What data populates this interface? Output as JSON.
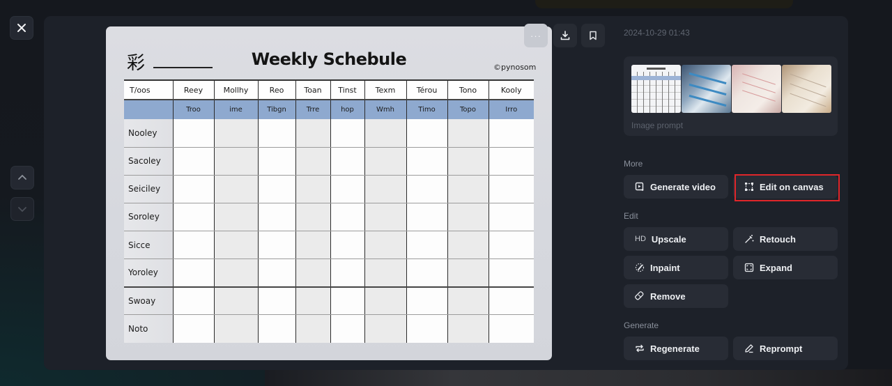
{
  "window": {
    "close_icon": "close-icon",
    "nav_up_icon": "chevron-up-icon",
    "nav_down_icon": "chevron-down-icon"
  },
  "image": {
    "logo_glyph": "彩",
    "title": "Weekly Schebule",
    "copyright": "©pynosom",
    "table": {
      "headers": [
        "T/oos",
        "Reey",
        "Mollhy",
        "Reo",
        "Toan",
        "Tinst",
        "Texm",
        "Térou",
        "Tono",
        "Kooly"
      ],
      "subheaders": [
        "",
        "Troo",
        "ime",
        "Tibgn",
        "Trre",
        "hop",
        "Wmh",
        "Timo",
        "Topo",
        "Irro"
      ],
      "rows": [
        "Nooley",
        "Sacoley",
        "Seiciley",
        "Soroley",
        "Sicce",
        "Yoroley",
        "Swoay",
        "Noto"
      ]
    }
  },
  "image_toolbar": {
    "more_label": "···",
    "more_icon": "more-horizontal-icon",
    "download_icon": "download-icon",
    "bookmark_icon": "bookmark-icon"
  },
  "sidebar": {
    "timestamp": "2024-10-29 01:43",
    "prompt_label": "Image prompt",
    "sections": {
      "more": "More",
      "edit": "Edit",
      "generate": "Generate"
    },
    "buttons": {
      "generate_video": "Generate video",
      "edit_on_canvas": "Edit on canvas",
      "upscale": "Upscale",
      "upscale_badge": "HD",
      "retouch": "Retouch",
      "inpaint": "Inpaint",
      "expand": "Expand",
      "remove": "Remove",
      "regenerate": "Regenerate",
      "reprompt": "Reprompt"
    },
    "highlight_color": "#e0262a"
  }
}
